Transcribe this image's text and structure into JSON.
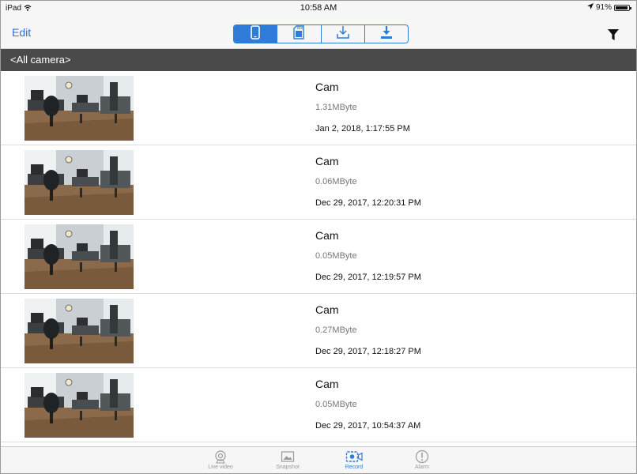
{
  "status_bar": {
    "device": "iPad",
    "time": "10:58 AM",
    "battery": "91%"
  },
  "nav": {
    "edit_label": "Edit",
    "segments": [
      {
        "icon": "phone-icon",
        "active": true
      },
      {
        "icon": "sd-card-icon",
        "active": false
      },
      {
        "icon": "download-outline-icon",
        "active": false
      },
      {
        "icon": "download-icon",
        "active": false
      }
    ],
    "filter_icon": "filter-icon"
  },
  "group_header": "<All camera>",
  "recordings": [
    {
      "name": "Cam",
      "size": "1.31MByte",
      "date": "Jan 2, 2018, 1:17:55 PM"
    },
    {
      "name": "Cam",
      "size": "0.06MByte",
      "date": "Dec 29, 2017, 12:20:31 PM"
    },
    {
      "name": "Cam",
      "size": "0.05MByte",
      "date": "Dec 29, 2017, 12:19:57 PM"
    },
    {
      "name": "Cam",
      "size": "0.27MByte",
      "date": "Dec 29, 2017, 12:18:27 PM"
    },
    {
      "name": "Cam",
      "size": "0.05MByte",
      "date": "Dec 29, 2017, 10:54:37 AM"
    }
  ],
  "tabs": [
    {
      "label": "Live video",
      "icon": "webcam-icon",
      "active": false
    },
    {
      "label": "Snapshot",
      "icon": "image-icon",
      "active": false
    },
    {
      "label": "Record",
      "icon": "video-record-icon",
      "active": true
    },
    {
      "label": "Alarm",
      "icon": "alert-icon",
      "active": false
    }
  ],
  "colors": {
    "accent": "#2f7bd8",
    "header_bg": "#4a4a4a",
    "bar_bg": "#f6f6f6"
  }
}
